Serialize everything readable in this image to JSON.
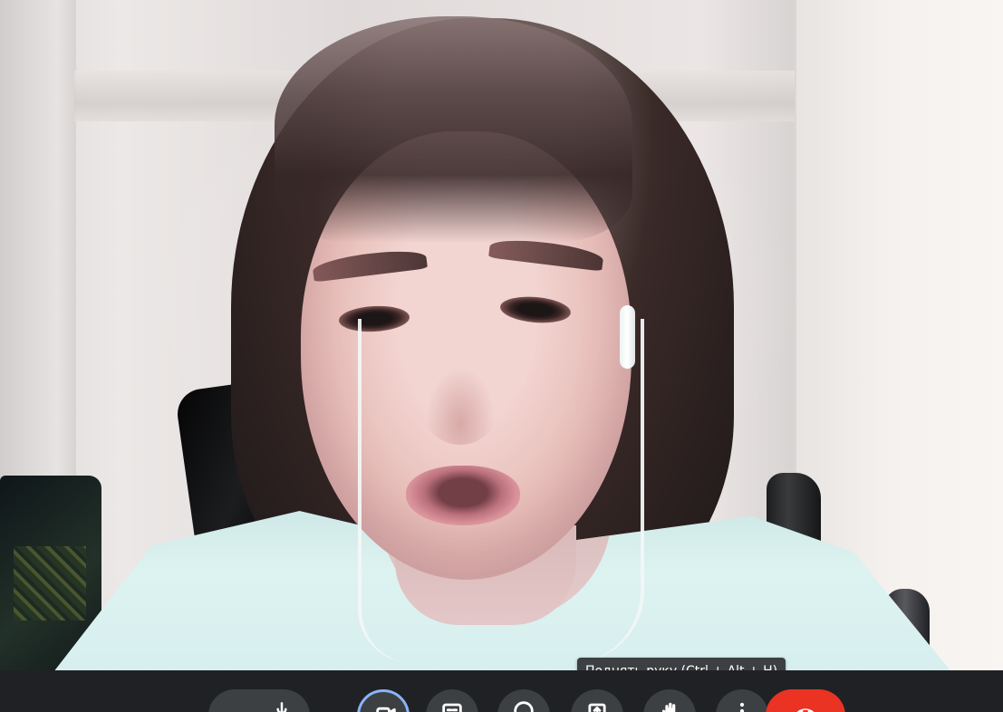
{
  "video": {
    "participant_label": ""
  },
  "toolbar": {
    "tooltip": "Поднять руку (Ctrl + Alt + H)",
    "buttons": [
      {
        "name": "mic-button",
        "icon": "mic-icon"
      },
      {
        "name": "camera-button",
        "icon": "camera-icon",
        "state": "active-focus"
      },
      {
        "name": "captions-button",
        "icon": "captions-icon"
      },
      {
        "name": "emoji-button",
        "icon": "emoji-icon"
      },
      {
        "name": "present-button",
        "icon": "present-icon"
      },
      {
        "name": "raise-hand-button",
        "icon": "hand-icon"
      },
      {
        "name": "more-options-button",
        "icon": "more-vertical-icon"
      },
      {
        "name": "leave-call-button",
        "icon": "phone-hangup-icon",
        "color": "#ea3323"
      }
    ],
    "colors": {
      "background": "#202124",
      "button": "#3c4043",
      "focus": "#8ab4f8",
      "end_call": "#ea3323"
    }
  }
}
